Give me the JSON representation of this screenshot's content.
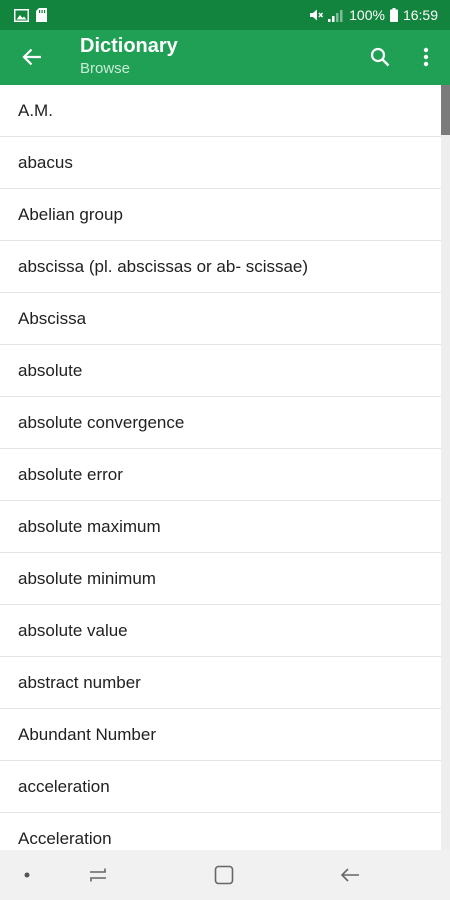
{
  "status_bar": {
    "battery_percent": "100%",
    "time": "16:59"
  },
  "app_bar": {
    "title": "Dictionary",
    "subtitle": "Browse",
    "color": "#1fa055",
    "status_color": "#13843e"
  },
  "icons": {
    "back": "arrow-back-icon",
    "search": "search-icon",
    "overflow": "more-vert-icon",
    "nav_dot": "dot-icon",
    "nav_recent": "recent-apps-icon",
    "nav_home": "home-icon",
    "nav_back": "back-icon"
  },
  "terms": [
    "A.M.",
    "abacus",
    "Abelian group",
    "abscissa (pl. abscissas or ab- scissae)",
    "Abscissa",
    "absolute",
    "absolute convergence",
    "absolute error",
    "absolute maximum",
    "absolute minimum",
    "absolute value",
    "abstract number",
    "Abundant Number",
    "acceleration",
    "Acceleration"
  ]
}
